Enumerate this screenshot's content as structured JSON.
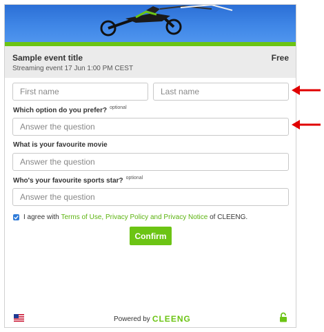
{
  "event": {
    "title": "Sample event title",
    "subtitle": "Streaming event 17 Jun 1:00 PM CEST",
    "price": "Free"
  },
  "form": {
    "first_name_placeholder": "First name",
    "last_name_placeholder": "Last name",
    "q1": {
      "label": "Which option do you prefer?",
      "tag": "optional",
      "placeholder": "Answer the question"
    },
    "q2": {
      "label": "What is your favourite movie",
      "placeholder": "Answer the question"
    },
    "q3": {
      "label": "Who's your favourite sports star?",
      "tag": "optional",
      "placeholder": "Answer the question"
    },
    "agree_prefix": "I agree with",
    "agree_link": "Terms of Use, Privacy Policy and Privacy Notice",
    "agree_suffix": "of CLEENG.",
    "confirm_label": "Confirm"
  },
  "footer": {
    "powered_by": "Powered by",
    "brand": "CLEENG"
  },
  "colors": {
    "accent": "#6cc414",
    "banner_blue": "#3f86e6",
    "arrow": "#e00000"
  },
  "icons": [
    "us-flag-icon",
    "lock-icon",
    "checkbox-checked-icon",
    "arrow-left-icon"
  ]
}
